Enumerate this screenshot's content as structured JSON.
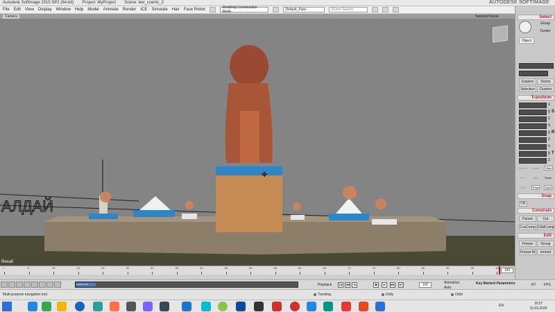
{
  "titlebar": {
    "app": "Autodesk Softimage 2015 SP2 (64-bit)",
    "project": "Project: MyProject",
    "scene": "Scene: lew_ccents_3",
    "brand": "AUTODESK SOFTIMAGE"
  },
  "menubar": {
    "items": [
      "File",
      "Edit",
      "View",
      "Display",
      "Window",
      "Help",
      "Model",
      "Animate",
      "Render",
      "ICE",
      "Simulate",
      "Hair",
      "Face Robot"
    ],
    "mode_select": "Modeling Construction Mode",
    "pass_select": "Default_Pass",
    "search_placeholder": "Scene Search"
  },
  "viewport": {
    "camera_label": "Camera",
    "mode_label": "Textured Decal",
    "corner_label": "Result",
    "bg_color": "#848484"
  },
  "timeline": {
    "ticks": [
      "1",
      "5",
      "10",
      "15",
      "20",
      "25",
      "30",
      "35",
      "40",
      "45",
      "50",
      "55",
      "60",
      "65",
      "70",
      "75",
      "80",
      "85",
      "90",
      "95",
      "100"
    ],
    "start_frame": "1",
    "end_frame": "100"
  },
  "transport": {
    "selection_value": "Viewport 3.9",
    "playback_label": "Playback",
    "current_frame": "100",
    "animation_label": "Animation",
    "auto_label": "Auto",
    "key_params_label": "Key Marked Parameters",
    "rt_labels": [
      "RT",
      "FPS"
    ]
  },
  "statusbar": {
    "hint": "Multi-purpose navigation tool",
    "mode_left": "Tracking",
    "mode_mid": "Dolly",
    "mode_right": "Orbit"
  },
  "rpanel": {
    "select_header": "Select",
    "group_btn": "Group",
    "center_btn": "Center",
    "object_btn": "Object",
    "explore_btn": "Explore",
    "scene_btn": "Scene",
    "selection_btn": "Selection",
    "clusters_btn": "Clusters",
    "transform_header": "Transform",
    "axis": [
      "x",
      "y",
      "z"
    ],
    "scale_label": "S",
    "rot_label": "R",
    "trans_label": "T",
    "global_tiny": [
      "Global",
      "Local",
      "View"
    ],
    "ref_tiny": [
      "Par",
      "Ref",
      "Plane"
    ],
    "cog_tiny": [
      "COG",
      "Prop",
      "Sym"
    ],
    "snap_header": "Snap",
    "on_label": "ON",
    "constrain_header": "Constrain",
    "parent_btn": "Parent",
    "cut_btn": "Cut",
    "cnscomp_btn": "CnsComp",
    "childcomp_btn": "ChldComp",
    "edit_header": "Edit",
    "freeze_btn": "Freeze",
    "group2_btn": "Group",
    "freezem_btn": "Freeze M",
    "immed_btn": "Immed"
  },
  "taskbar": {
    "lang": "EN",
    "time": "16:57",
    "date": "15.03.2020",
    "icon_colors": [
      "#2d6fd6",
      "#1e88e5",
      "#34a853",
      "#f4b400",
      "#1565c0",
      "#2aa198",
      "#ff7043",
      "#555555",
      "#7b61ff",
      "#37474f",
      "#1976d2",
      "#00bcd4",
      "#8bc34a",
      "#0d47a1",
      "#333333",
      "#d32f2f",
      "#d32f2f",
      "#1e88e5",
      "#009688",
      "#e53935",
      "#e64a19"
    ]
  }
}
